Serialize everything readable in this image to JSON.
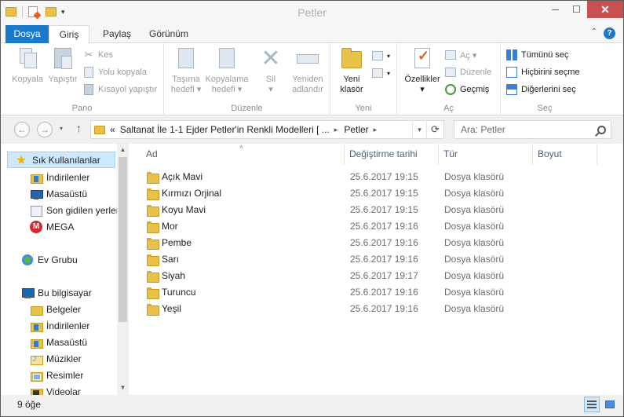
{
  "window": {
    "title": "Petler"
  },
  "qat": {
    "dropdown_glyph": "▾"
  },
  "window_controls": {
    "minimize": "─",
    "maximize": "☐",
    "close": "✕"
  },
  "ribbon_tabs": [
    {
      "label": "Dosya"
    },
    {
      "label": "Giriş"
    },
    {
      "label": "Paylaş"
    },
    {
      "label": "Görünüm"
    }
  ],
  "ribbon": {
    "groups": {
      "pano": "Pano",
      "duzenle": "Düzenle",
      "yeni": "Yeni",
      "ac": "Aç",
      "sec": "Seç"
    },
    "buttons": {
      "kopyala": "Kopyala",
      "yapistir": "Yapıştır",
      "kes": "Kes",
      "yolu_kopyala": "Yolu kopyala",
      "kisayol_yapistir": "Kısayol yapıştır",
      "tasima_hedefi_1": "Taşıma",
      "tasima_hedefi_2": "hedefi ▾",
      "kopyalama_hedefi_1": "Kopyalama",
      "kopyalama_hedefi_2": "hedefi ▾",
      "sil_1": "Sil",
      "sil_2": "▾",
      "yeniden_adlandir_1": "Yeniden",
      "yeniden_adlandir_2": "adlandır",
      "yeni_klasor_1": "Yeni",
      "yeni_klasor_2": "klasör",
      "ozellikler_1": "Özellikler",
      "ozellikler_2": "▾",
      "ac": "Aç ▾",
      "duzenle": "Düzenle",
      "gecmis": "Geçmiş",
      "tumunu_sec": "Tümünü seç",
      "hicbirini_secme": "Hiçbirini seçme",
      "digerlerini_sec": "Diğerlerini seç"
    }
  },
  "nav": {
    "back": "←",
    "forward": "→",
    "dropdown": "▾",
    "up": "↑",
    "address": {
      "overflow": "«",
      "segment_parent": "Saltanat İle 1-1 Ejder Petler'in Renkli Modelleri [ ...",
      "separator": "▸",
      "segment_current": "Petler",
      "separator_end": "▸",
      "dropdown": "▾",
      "refresh": "⟳"
    },
    "search": {
      "placeholder": "Ara: Petler"
    }
  },
  "navigation_pane": {
    "items": [
      {
        "label": "Sık Kullanılanlar",
        "icon": "star-icon"
      },
      {
        "label": "İndirilenler",
        "icon": "downloads-folder-icon"
      },
      {
        "label": "Masaüstü",
        "icon": "desktop-icon"
      },
      {
        "label": "Son gidilen yerler",
        "icon": "recent-places-icon"
      },
      {
        "label": "MEGA",
        "icon": "mega-icon"
      },
      {
        "label": "Ev Grubu",
        "icon": "homegroup-icon"
      },
      {
        "label": "Bu bilgisayar",
        "icon": "this-pc-icon"
      },
      {
        "label": "Belgeler",
        "icon": "documents-folder-icon"
      },
      {
        "label": "İndirilenler",
        "icon": "downloads-folder-icon"
      },
      {
        "label": "Masaüstü",
        "icon": "desktop-folder-icon"
      },
      {
        "label": "Müzikler",
        "icon": "music-folder-icon"
      },
      {
        "label": "Resimler",
        "icon": "pictures-folder-icon"
      },
      {
        "label": "Videolar",
        "icon": "videos-folder-icon"
      }
    ],
    "scroll_up": "▲",
    "scroll_down": "▼"
  },
  "file_list": {
    "columns": {
      "name": "Ad",
      "modified": "Değiştirme tarihi",
      "type": "Tür",
      "size": "Boyut"
    },
    "sort_indicator": "˄",
    "rows": [
      {
        "name": "Açık Mavi",
        "modified": "25.6.2017 19:15",
        "type": "Dosya klasörü"
      },
      {
        "name": "Kırmızı Orjinal",
        "modified": "25.6.2017 19:15",
        "type": "Dosya klasörü"
      },
      {
        "name": "Koyu Mavi",
        "modified": "25.6.2017 19:15",
        "type": "Dosya klasörü"
      },
      {
        "name": "Mor",
        "modified": "25.6.2017 19:16",
        "type": "Dosya klasörü"
      },
      {
        "name": "Pembe",
        "modified": "25.6.2017 19:16",
        "type": "Dosya klasörü"
      },
      {
        "name": "Sarı",
        "modified": "25.6.2017 19:16",
        "type": "Dosya klasörü"
      },
      {
        "name": "Siyah",
        "modified": "25.6.2017 19:17",
        "type": "Dosya klasörü"
      },
      {
        "name": "Turuncu",
        "modified": "25.6.2017 19:16",
        "type": "Dosya klasörü"
      },
      {
        "name": "Yeşil",
        "modified": "25.6.2017 19:16",
        "type": "Dosya klasörü"
      }
    ]
  },
  "status": {
    "item_count": "9 öğe"
  },
  "colors": {
    "accent": "#1979ca",
    "folder": "#e8c14a",
    "close": "#c75050",
    "selection": "#cde8ff"
  }
}
